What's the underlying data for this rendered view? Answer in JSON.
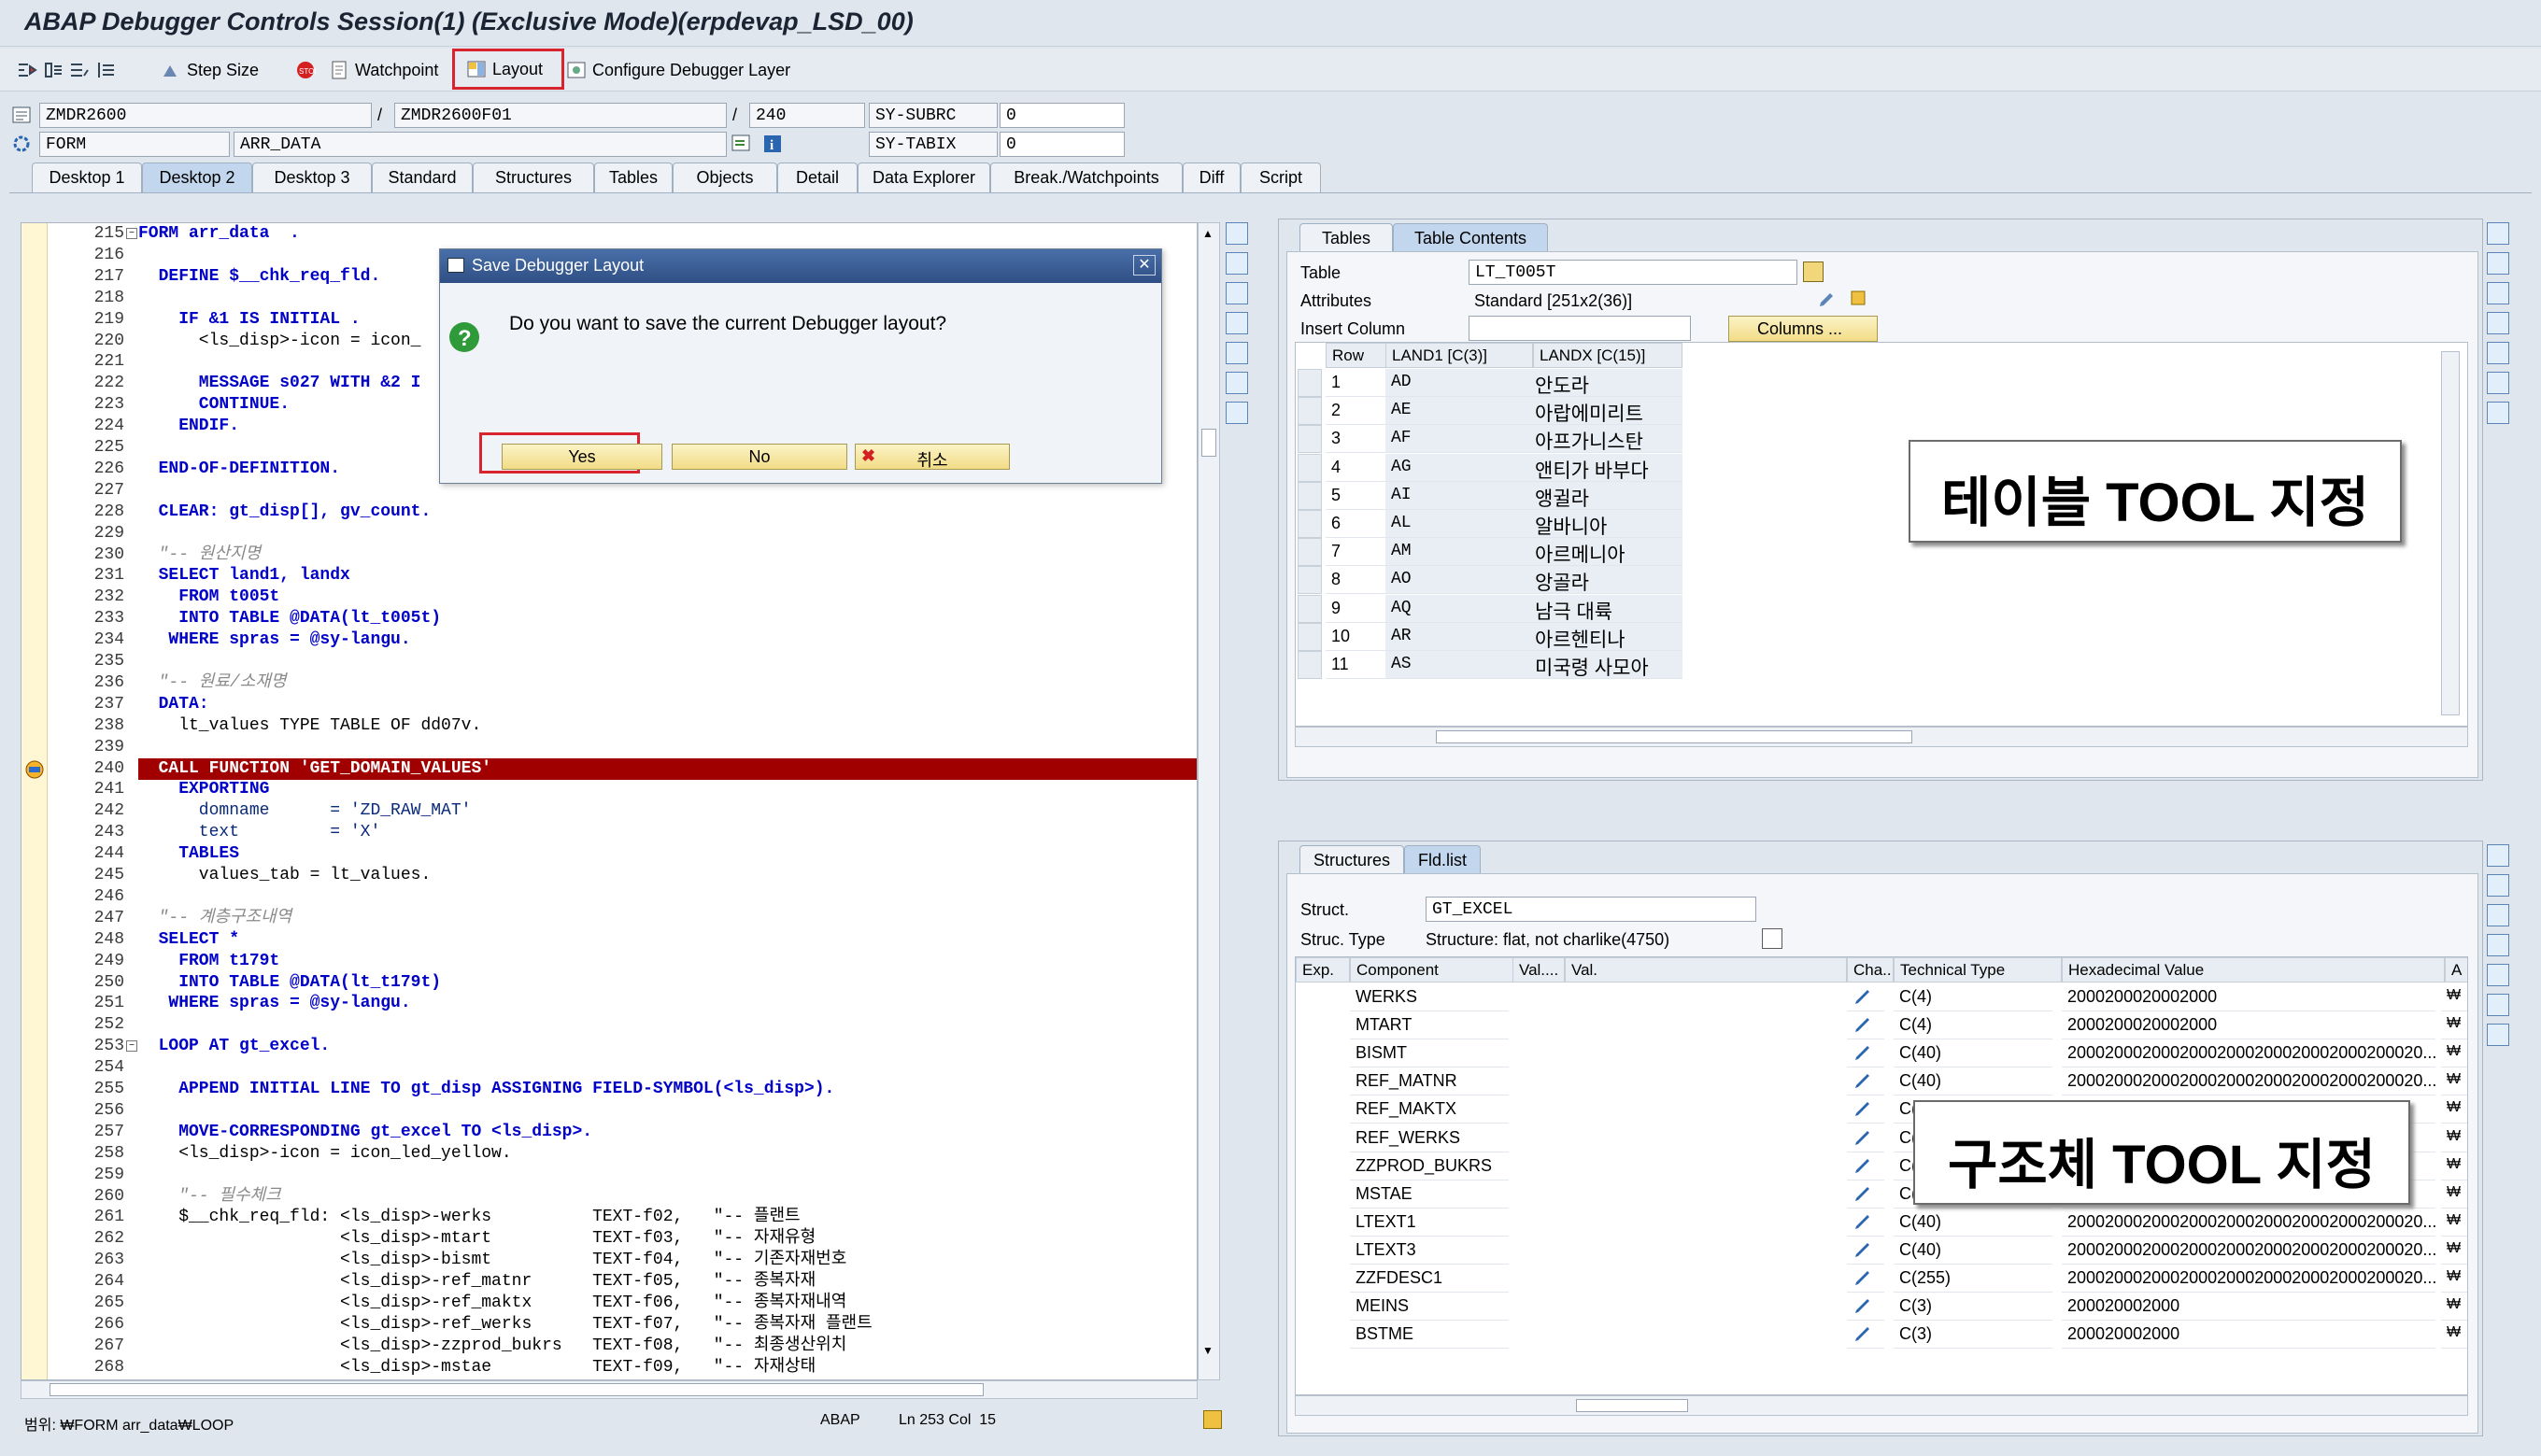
{
  "window": {
    "title": "ABAP Debugger Controls Session(1)  (Exclusive Mode)(erpdevap_LSD_00)"
  },
  "toolbar": {
    "step_size": "Step Size",
    "watchpoint": "Watchpoint",
    "layout": "Layout",
    "configure": "Configure Debugger Layer"
  },
  "header": {
    "program": "ZMDR2600",
    "include": "ZMDR2600F01",
    "line": "240",
    "sy_subrc_label": "SY-SUBRC",
    "sy_subrc_value": "0",
    "event_type": "FORM",
    "event": "ARR_DATA",
    "sy_tabix_label": "SY-TABIX",
    "sy_tabix_value": "0",
    "slash1": "/",
    "slash2": "/"
  },
  "tabs": [
    "Desktop 1",
    "Desktop 2",
    "Desktop 3",
    "Standard",
    "Structures",
    "Tables",
    "Objects",
    "Detail",
    "Data Explorer",
    "Break./Watchpoints",
    "Diff",
    "Script"
  ],
  "code": {
    "lines": [
      {
        "n": "215",
        "t": "FORM arr_data  ."
      },
      {
        "n": "216",
        "t": ""
      },
      {
        "n": "217",
        "t": "  DEFINE $__chk_req_fld."
      },
      {
        "n": "218",
        "t": ""
      },
      {
        "n": "219",
        "t": "    IF &1 IS INITIAL ."
      },
      {
        "n": "220",
        "t": "      <ls_disp>-icon = icon_"
      },
      {
        "n": "221",
        "t": ""
      },
      {
        "n": "222",
        "t": "      MESSAGE s027 WITH &2 I"
      },
      {
        "n": "223",
        "t": "      CONTINUE."
      },
      {
        "n": "224",
        "t": "    ENDIF."
      },
      {
        "n": "225",
        "t": ""
      },
      {
        "n": "226",
        "t": "  END-OF-DEFINITION."
      },
      {
        "n": "227",
        "t": ""
      },
      {
        "n": "228",
        "t": "  CLEAR: gt_disp[], gv_count."
      },
      {
        "n": "229",
        "t": ""
      },
      {
        "n": "230",
        "t": "  \"-- 원산지명"
      },
      {
        "n": "231",
        "t": "  SELECT land1, landx"
      },
      {
        "n": "232",
        "t": "    FROM t005t"
      },
      {
        "n": "233",
        "t": "    INTO TABLE @DATA(lt_t005t)"
      },
      {
        "n": "234",
        "t": "   WHERE spras = @sy-langu."
      },
      {
        "n": "235",
        "t": ""
      },
      {
        "n": "236",
        "t": "  \"-- 원료/소재명"
      },
      {
        "n": "237",
        "t": "  DATA:"
      },
      {
        "n": "238",
        "t": "    lt_values TYPE TABLE OF dd07v."
      },
      {
        "n": "239",
        "t": ""
      },
      {
        "n": "240",
        "t": "  CALL FUNCTION 'GET_DOMAIN_VALUES'"
      },
      {
        "n": "241",
        "t": "    EXPORTING"
      },
      {
        "n": "242",
        "t": "      domname      = 'ZD_RAW_MAT'"
      },
      {
        "n": "243",
        "t": "      text         = 'X'"
      },
      {
        "n": "244",
        "t": "    TABLES"
      },
      {
        "n": "245",
        "t": "      values_tab = lt_values."
      },
      {
        "n": "246",
        "t": ""
      },
      {
        "n": "247",
        "t": "  \"-- 계층구조내역"
      },
      {
        "n": "248",
        "t": "  SELECT *"
      },
      {
        "n": "249",
        "t": "    FROM t179t"
      },
      {
        "n": "250",
        "t": "    INTO TABLE @DATA(lt_t179t)"
      },
      {
        "n": "251",
        "t": "   WHERE spras = @sy-langu."
      },
      {
        "n": "252",
        "t": ""
      },
      {
        "n": "253",
        "t": "  LOOP AT gt_excel."
      },
      {
        "n": "254",
        "t": ""
      },
      {
        "n": "255",
        "t": "    APPEND INITIAL LINE TO gt_disp ASSIGNING FIELD-SYMBOL(<ls_disp>)."
      },
      {
        "n": "256",
        "t": ""
      },
      {
        "n": "257",
        "t": "    MOVE-CORRESPONDING gt_excel TO <ls_disp>."
      },
      {
        "n": "258",
        "t": "    <ls_disp>-icon = icon_led_yellow."
      },
      {
        "n": "259",
        "t": ""
      },
      {
        "n": "260",
        "t": "    \"-- 필수체크"
      },
      {
        "n": "261",
        "t": "    $__chk_req_fld: <ls_disp>-werks          TEXT-f02,   \"-- 플랜트"
      },
      {
        "n": "262",
        "t": "                    <ls_disp>-mtart          TEXT-f03,   \"-- 자재유형"
      },
      {
        "n": "263",
        "t": "                    <ls_disp>-bismt          TEXT-f04,   \"-- 기존자재번호"
      },
      {
        "n": "264",
        "t": "                    <ls_disp>-ref_matnr      TEXT-f05,   \"-- 종복자재"
      },
      {
        "n": "265",
        "t": "                    <ls_disp>-ref_maktx      TEXT-f06,   \"-- 종복자재내역"
      },
      {
        "n": "266",
        "t": "                    <ls_disp>-ref_werks      TEXT-f07,   \"-- 종복자재 플랜트"
      },
      {
        "n": "267",
        "t": "                    <ls_disp>-zzprod_bukrs   TEXT-f08,   \"-- 최종생산위치"
      },
      {
        "n": "268",
        "t": "                    <ls_disp>-mstae          TEXT-f09,   \"-- 자재상태"
      }
    ]
  },
  "status": {
    "scope": "범위: ₩FORM arr_data₩LOOP",
    "lang": "ABAP",
    "position": "Ln 253 Col  15"
  },
  "dialog": {
    "title": "Save Debugger Layout",
    "message": "Do you want to save the current Debugger layout?",
    "yes": "Yes",
    "no": "No",
    "cancel": "취소"
  },
  "tables_tool": {
    "tabs": [
      "Tables",
      "Table Contents"
    ],
    "table_label": "Table",
    "table_value": "LT_T005T",
    "attributes_label": "Attributes",
    "attributes_value": "Standard [251x2(36)]",
    "insert_column_label": "Insert Column",
    "columns_button": "Columns ...",
    "headers": [
      "Row",
      "LAND1 [C(3)]",
      "LANDX [C(15)]"
    ],
    "rows": [
      [
        "1",
        "AD",
        "안도라"
      ],
      [
        "2",
        "AE",
        "아랍에미리트"
      ],
      [
        "3",
        "AF",
        "아프가니스탄"
      ],
      [
        "4",
        "AG",
        "앤티가 바부다"
      ],
      [
        "5",
        "AI",
        "앵귈라"
      ],
      [
        "6",
        "AL",
        "알바니아"
      ],
      [
        "7",
        "AM",
        "아르메니아"
      ],
      [
        "8",
        "AO",
        "앙골라"
      ],
      [
        "9",
        "AQ",
        "남극 대륙"
      ],
      [
        "10",
        "AR",
        "아르헨티나"
      ],
      [
        "11",
        "AS",
        "미국령 사모아"
      ]
    ],
    "callout": "테이블 TOOL 지정"
  },
  "struct_tool": {
    "tabs": [
      "Structures",
      "Fld.list"
    ],
    "struct_label": "Struct.",
    "struct_value": "GT_EXCEL",
    "type_label": "Struc. Type",
    "type_value": "Structure: flat, not charlike(4750)",
    "headers": [
      "Exp.",
      "Component",
      "Val....",
      "Val.",
      "Cha...",
      "Technical Type",
      "Hexadecimal Value",
      "A"
    ],
    "rows": [
      [
        "WERKS",
        "C(4)",
        "2000200020002000"
      ],
      [
        "MTART",
        "C(4)",
        "2000200020002000"
      ],
      [
        "BISMT",
        "C(40)",
        "20002000200020002000200020002000200020..."
      ],
      [
        "REF_MATNR",
        "C(40)",
        "20002000200020002000200020002000200020..."
      ],
      [
        "REF_MAKTX",
        "C(40",
        ""
      ],
      [
        "REF_WERKS",
        "C(4)",
        ""
      ],
      [
        "ZZPROD_BUKRS",
        "C(4)",
        ""
      ],
      [
        "MSTAE",
        "C(2)",
        ""
      ],
      [
        "LTEXT1",
        "C(40)",
        "20002000200020002000200020002000200020..."
      ],
      [
        "LTEXT3",
        "C(40)",
        "20002000200020002000200020002000200020..."
      ],
      [
        "ZZFDESC1",
        "C(255)",
        "20002000200020002000200020002000200020..."
      ],
      [
        "MEINS",
        "C(3)",
        "200020002000"
      ],
      [
        "BSTME",
        "C(3)",
        "200020002000"
      ]
    ],
    "callout": "구조체 TOOL 지정"
  }
}
